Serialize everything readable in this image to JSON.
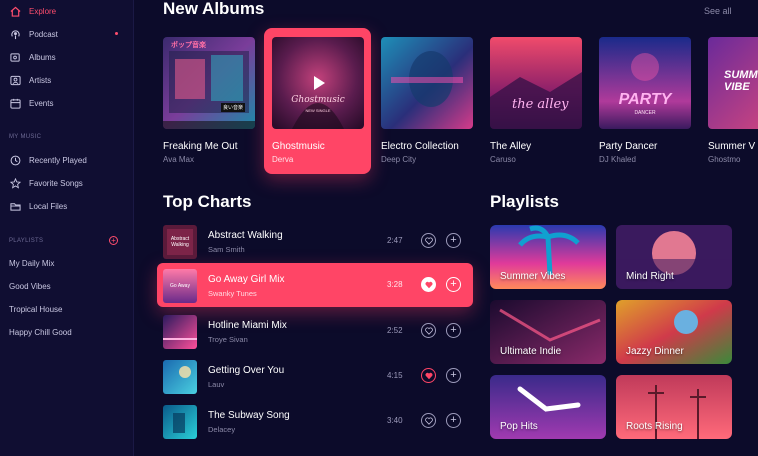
{
  "sidebar": {
    "nav": [
      {
        "label": "Explore",
        "icon": "home-icon"
      },
      {
        "label": "Podcast",
        "icon": "podcast-icon"
      },
      {
        "label": "Albums",
        "icon": "album-icon"
      },
      {
        "label": "Artists",
        "icon": "artist-icon"
      },
      {
        "label": "Events",
        "icon": "calendar-icon"
      }
    ],
    "my_music_label": "MY MUSIC",
    "my_music": [
      {
        "label": "Recently Played",
        "icon": "clock-icon"
      },
      {
        "label": "Favorite Songs",
        "icon": "star-icon"
      },
      {
        "label": "Local Files",
        "icon": "folder-icon"
      }
    ],
    "playlists_label": "PLAYLISTS",
    "playlists": [
      "My Daily Mix",
      "Good Vibes",
      "Tropical House",
      "Happy Chill Good"
    ]
  },
  "albums": {
    "heading": "New Albums",
    "see_all": "See all",
    "items": [
      {
        "title": "Freaking Me Out",
        "artist": "Ava Max"
      },
      {
        "title": "Ghostmusic",
        "artist": "Derva"
      },
      {
        "title": "Electro Collection",
        "artist": "Deep City"
      },
      {
        "title": "The Alley",
        "artist": "Caruso"
      },
      {
        "title": "Party Dancer",
        "artist": "DJ Khaled"
      },
      {
        "title": "Summer V",
        "artist": "Ghostmo"
      }
    ]
  },
  "charts": {
    "heading": "Top Charts",
    "tracks": [
      {
        "name": "Abstract Walking",
        "artist": "Sam Smith",
        "duration": "2:47"
      },
      {
        "name": "Go Away Girl Mix",
        "artist": "Swanky Tunes",
        "duration": "3:28"
      },
      {
        "name": "Hotline Miami Mix",
        "artist": "Troye Sivan",
        "duration": "2:52"
      },
      {
        "name": "Getting Over You",
        "artist": "Lauv",
        "duration": "4:15"
      },
      {
        "name": "The Subway Song",
        "artist": "Delacey",
        "duration": "3:40"
      }
    ]
  },
  "playlists": {
    "heading": "Playlists",
    "items": [
      "Summer Vibes",
      "Mind Right",
      "Ultimate Indie",
      "Jazzy Dinner",
      "Pop Hits",
      "Roots Rising"
    ]
  },
  "cover_art": {
    "album_1": {
      "jp_top": "ポップ音楽",
      "jp_badge": "良い音楽"
    },
    "album_2": {
      "logo": "Ghostmusic",
      "sub": "NEW SINGLE"
    },
    "album_4": {
      "logo": "the alley"
    },
    "album_5": {
      "logo": "PARTY",
      "sub": "DANCER"
    },
    "album_6": {
      "logo": "SUMM VIBE"
    },
    "track_1": {
      "logo": "Abstract Walking"
    },
    "track_2": {
      "logo": "Go Away"
    }
  },
  "colors": {
    "accent": "#ff4566",
    "background": "#0c0b2a",
    "sidebar": "#100e32"
  }
}
